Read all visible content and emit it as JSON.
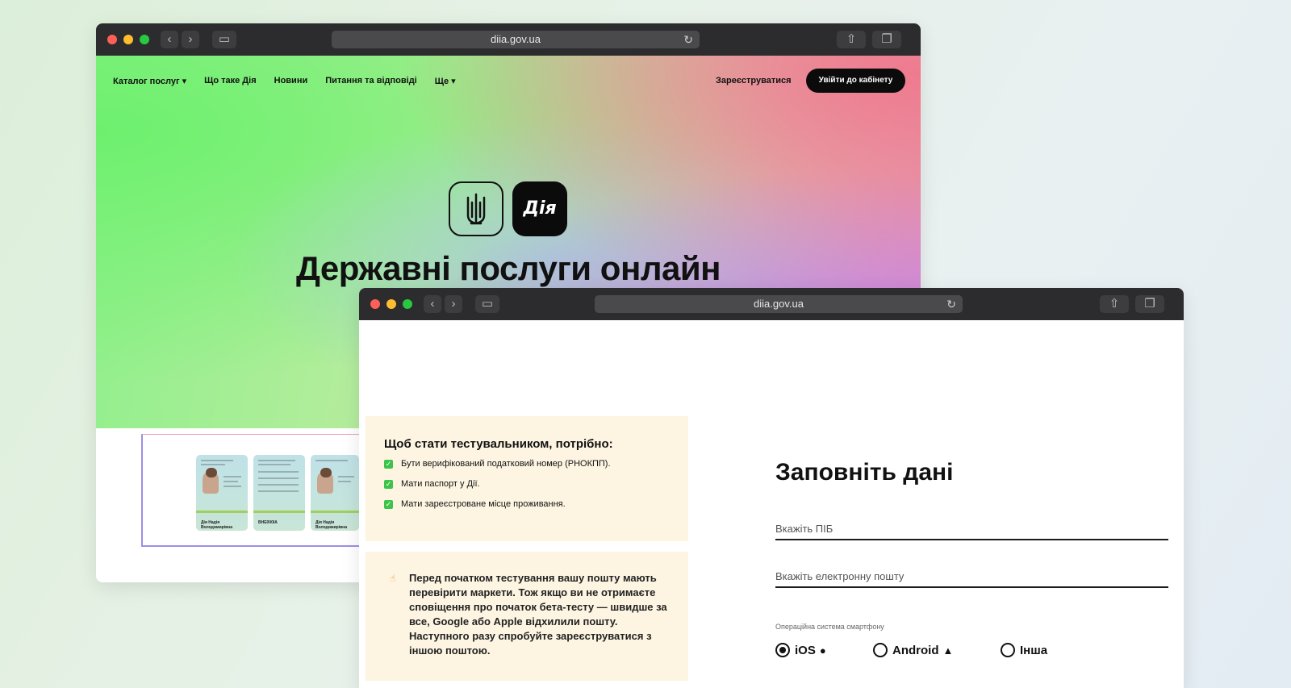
{
  "back_window": {
    "url": "diia.gov.ua",
    "nav": {
      "items": [
        "Каталог послуг ▾",
        "Що таке Дія",
        "Новини",
        "Питання та відповіді",
        "Ще ▾"
      ],
      "register_link": "Зареєструватися",
      "login_button": "Увійти до кабінету"
    },
    "logo_text": "Дія",
    "hero_title": "Державні послуги онлайн",
    "cards": [
      {
        "label": "Дія Надія Володимирівна"
      },
      {
        "label": "ВНЕ000ІА"
      },
      {
        "label": "Дія Надія Володимирівна"
      }
    ]
  },
  "front_window": {
    "url": "diia.gov.ua",
    "requirements": {
      "title": "Щоб стати тестувальником, потрібно:",
      "items": [
        "Бути верифікований податковий номер (РНОКПП).",
        "Мати паспорт у Дії.",
        "Мати зареєстроване місце проживання."
      ]
    },
    "note": {
      "icon": "hand-icon",
      "text": "Перед початком тестування вашу пошту мають перевірити маркети. Тож якщо ви не отримаєте сповіщення про початок бета-тесту — швидше за все, Google або Apple відхилили пошту. Наступного разу спробуйте  зареєструватися з іншою поштою."
    },
    "form": {
      "title": "Заповніть дані",
      "name_placeholder": "Вкажіть ПІБ",
      "email_placeholder": "Вкажіть електронну пошту",
      "os_label": "Операційна система смартфону",
      "os_options": [
        {
          "label": "iOS",
          "selected": true
        },
        {
          "label": "Android",
          "selected": false
        },
        {
          "label": "Інша",
          "selected": false
        }
      ]
    }
  },
  "colors": {
    "titlebar": "#2c2c2e",
    "check_green": "#3cc44a",
    "note_bg": "#fdf5e2"
  }
}
